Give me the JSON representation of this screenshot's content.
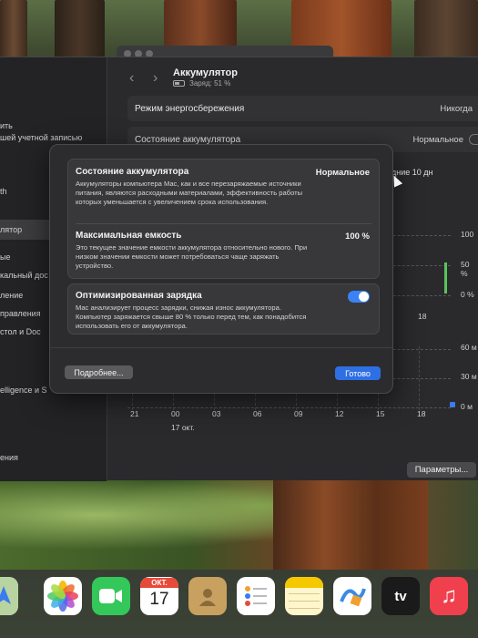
{
  "sidebar": {
    "items": [
      "ить",
      "шей учетной записью",
      "th",
      "лятор",
      "ые",
      "кальный дос",
      "ление",
      "правления",
      "стол и Doc",
      "elligence и S",
      "ения"
    ]
  },
  "header": {
    "title": "Аккумулятор",
    "subtitle": "Заряд: 51 %"
  },
  "settings": {
    "energy_mode_label": "Режим энергосбережения",
    "energy_mode_value": "Никогда",
    "battery_state_label": "Состояние аккумулятора",
    "battery_state_value": "Нормальное"
  },
  "chart": {
    "period_label": "дние 10 дн",
    "y_ticks_top": [
      "100",
      "50 %",
      "0 %"
    ],
    "y_ticks_bottom": [
      "60 м",
      "30 м",
      "0 м"
    ],
    "x_ticks": [
      "21",
      "00",
      "03",
      "06",
      "09",
      "12",
      "15",
      "18"
    ],
    "upper_x_tick": "18",
    "date_label": "17 окт.",
    "params_button": "Параметры..."
  },
  "sheet": {
    "health_title": "Состояние аккумулятора",
    "health_value": "Нормальное",
    "health_desc": "Аккумуляторы компьютера Mac, как и все перезаряжаемые источники питания, являются расходными материалами, эффективность работы которых уменьшается с увеличением срока использования.",
    "capacity_title": "Максимальная емкость",
    "capacity_value": "100 %",
    "capacity_desc": "Это текущее значение емкости аккумулятора относительно нового. При низком значении емкости может потребоваться чаще заряжать устройство.",
    "optimized_title": "Оптимизированная зарядка",
    "optimized_desc": "Mac анализирует процесс зарядки, снижая износ аккумулятора. Компьютер заряжается свыше 80 % только перед тем, как понадобится использовать его от аккумулятора.",
    "more_button": "Подробнее...",
    "done_button": "Готово"
  },
  "dock": {
    "calendar_month": "ОКТ.",
    "calendar_day": "17",
    "tv_label": "tv"
  },
  "colors": {
    "accent": "#3a82f6",
    "toggle_on": "#3a82f6",
    "calendar_red": "#e84a3a"
  }
}
